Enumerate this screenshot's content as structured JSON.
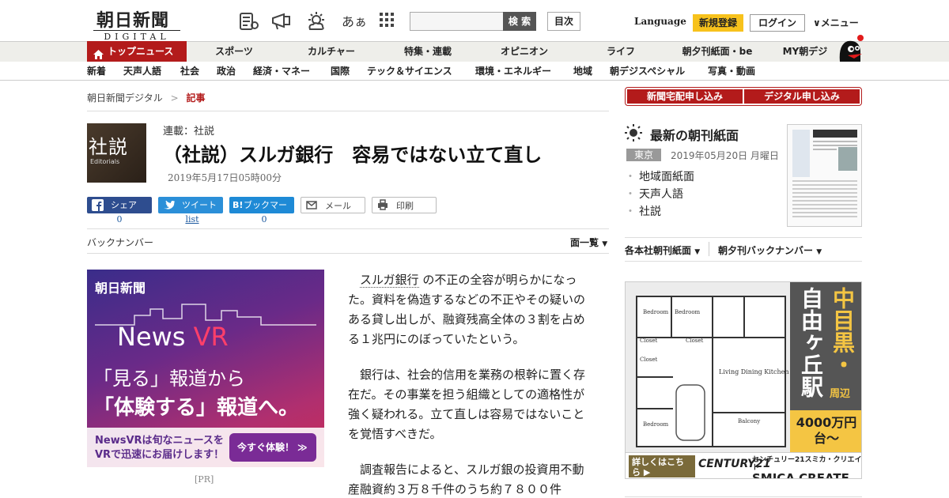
{
  "header": {
    "logo_jp": "朝日新聞",
    "logo_en": "DIGITAL",
    "font_toggle": "あぁ",
    "search_btn": "検 索",
    "toc_btn": "目次",
    "language": "Language",
    "signup": "新規登録",
    "login": "ログイン",
    "menu": "メニュー"
  },
  "nav_primary": [
    "トップニュース",
    "スポーツ",
    "カルチャー",
    "特集・連載",
    "オピニオン",
    "ライフ",
    "朝夕刊紙面・be",
    "MY朝デジ"
  ],
  "nav_secondary": [
    "新着",
    "天声人語",
    "社会",
    "政治",
    "経済・マネー",
    "国際",
    "テック＆サイエンス",
    "環境・エネルギー",
    "地域",
    "朝デジスペシャル",
    "写真・動画"
  ],
  "breadcrumb": {
    "home": "朝日新聞デジタル",
    "sep": ">",
    "current": "記事"
  },
  "article": {
    "badge_jp": "社説",
    "badge_en": "Editorials",
    "series": "連載：社説",
    "title": "（社説）スルガ銀行　容易ではない立て直し",
    "date": "2019年5月17日05時00分",
    "share": {
      "facebook": "シェア",
      "facebook_count": "0",
      "twitter": "ツイート",
      "twitter_count": "list",
      "hatena": "ブックマーク",
      "hatena_count": "0",
      "mail": "メール",
      "print": "印刷"
    },
    "back_numbers": "バックナンバー",
    "all_pages": "面一覧",
    "para1_link": "スルガ銀行",
    "para1_rest": "の不正の全容が明らかになった。資料を偽造するなどの不正やその疑いのある貸し出しが、融資残高全体の３割を占める１兆円にのぼっていたという。",
    "para2": "銀行は、社会的信用を業務の根幹に置く存在だ。その事業を担う組織としての適格性が強く疑われる。立て直しは容易ではないことを覚悟すべきだ。",
    "para3": "調査報告によると、スルガ銀の投資用不動産融資約３万８千件のうち約７８００件"
  },
  "ad_left": {
    "logo": "朝日新聞",
    "title_a": "News ",
    "title_b": "VR",
    "line1": "「見る」報道から",
    "line2": "「体験する」報道へ。",
    "bottom_text": "NewsVRは旬なニュースをVRで迅速にお届けします！",
    "cta": "今すぐ体験！",
    "pr_label": "[PR]"
  },
  "sidebar": {
    "sub_delivery": "新聞宅配申し込み",
    "sub_digital": "デジタル申し込み",
    "latest_title": "最新の朝刊紙面",
    "region": "東京",
    "paper_date": "2019年05月20日 月曜日",
    "links": [
      "地域面紙面",
      "天声人語",
      "社説"
    ],
    "edition": "各本社朝刊紙面",
    "backnum": "朝夕刊バックナンバー"
  },
  "ad_right": {
    "area1": "中目黒・",
    "area2": "自由ヶ丘駅",
    "area_suffix": "周辺",
    "price": "4000万円台〜",
    "more": "詳しくはこちら",
    "brand1": "CENTURY21",
    "brand_small": "センチュリー21スミカ・クリエイト",
    "brand_big": "SMICA CREATE",
    "rooms": [
      "Bedroom",
      "Bedroom",
      "Living Dining Kitchen",
      "Bedroom",
      "Closet",
      "Closet",
      "Closet",
      "Balcony"
    ]
  },
  "colors": {
    "brand_red": "#b31b1b",
    "twitter": "#1da1f2",
    "facebook": "#3b5998",
    "hatena": "#1e8ad6",
    "signup_yellow": "#f7c21c"
  }
}
